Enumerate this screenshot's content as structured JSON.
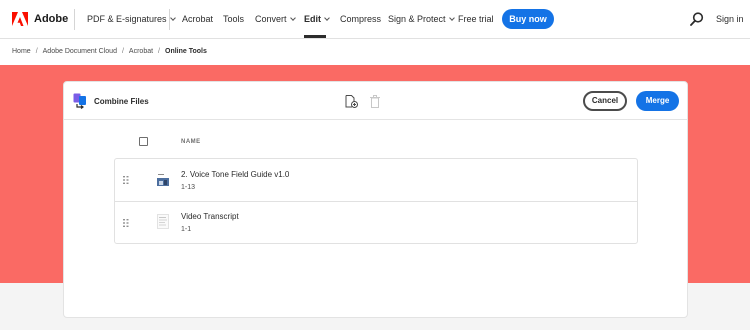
{
  "brand": {
    "name": "Adobe",
    "accent": "#fa0f00"
  },
  "nav": {
    "items": [
      {
        "label": "PDF & E-signatures",
        "has_menu": true
      },
      {
        "label": "Acrobat",
        "has_menu": false
      },
      {
        "label": "Tools",
        "has_menu": false
      },
      {
        "label": "Convert",
        "has_menu": true
      },
      {
        "label": "Edit",
        "has_menu": true,
        "active": true
      },
      {
        "label": "Compress",
        "has_menu": false
      },
      {
        "label": "Sign & Protect",
        "has_menu": true
      },
      {
        "label": "Free trial",
        "has_menu": false
      }
    ],
    "buy_label": "Buy now",
    "search_icon": "search-icon",
    "signin_label": "Sign in",
    "buy_color": "#1473e6"
  },
  "breadcrumb": {
    "items": [
      "Home",
      "Adobe Document Cloud",
      "Acrobat"
    ],
    "current": "Online Tools",
    "separator": "/"
  },
  "hero": {
    "color": "#fa6a64"
  },
  "tool": {
    "title": "Combine Files",
    "icon": "combine-files-icon",
    "add_icon": "add-file-icon",
    "delete_icon": "trash-icon",
    "cancel_label": "Cancel",
    "merge_label": "Merge",
    "column_header": "NAME",
    "files": [
      {
        "name": "2. Voice Tone Field Guide v1.0",
        "pages": "1-13",
        "thumb": "image-thumbnail"
      },
      {
        "name": "Video Transcript",
        "pages": "1-1",
        "thumb": "document-thumbnail"
      }
    ]
  }
}
